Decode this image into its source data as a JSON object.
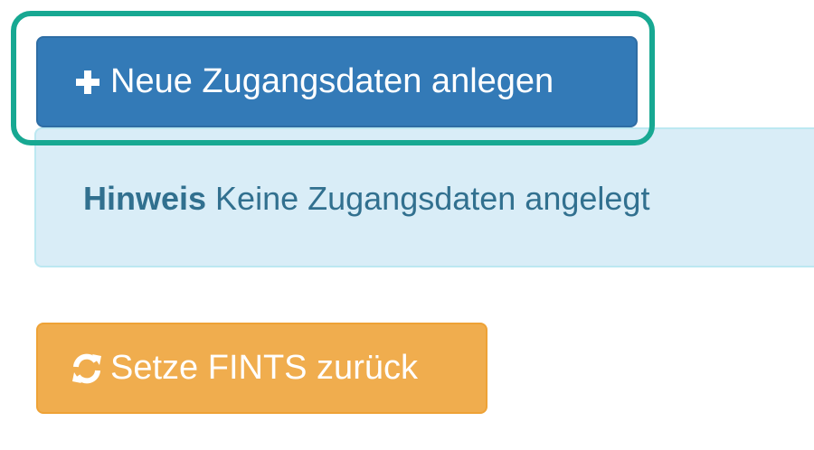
{
  "actions": {
    "new_credentials_label": "Neue Zugangsdaten anlegen",
    "reset_fints_label": "Setze FINTS zurück"
  },
  "alert": {
    "title": "Hinweis",
    "message": "Keine Zugangsdaten angelegt"
  },
  "icons": {
    "new_credentials": "plus-icon",
    "reset_fints": "refresh-icon"
  },
  "colors": {
    "primary": "#337ab7",
    "warning": "#f0ad4e",
    "info_bg": "#d9edf7",
    "info_text": "#31708f",
    "highlight": "#17a892"
  }
}
